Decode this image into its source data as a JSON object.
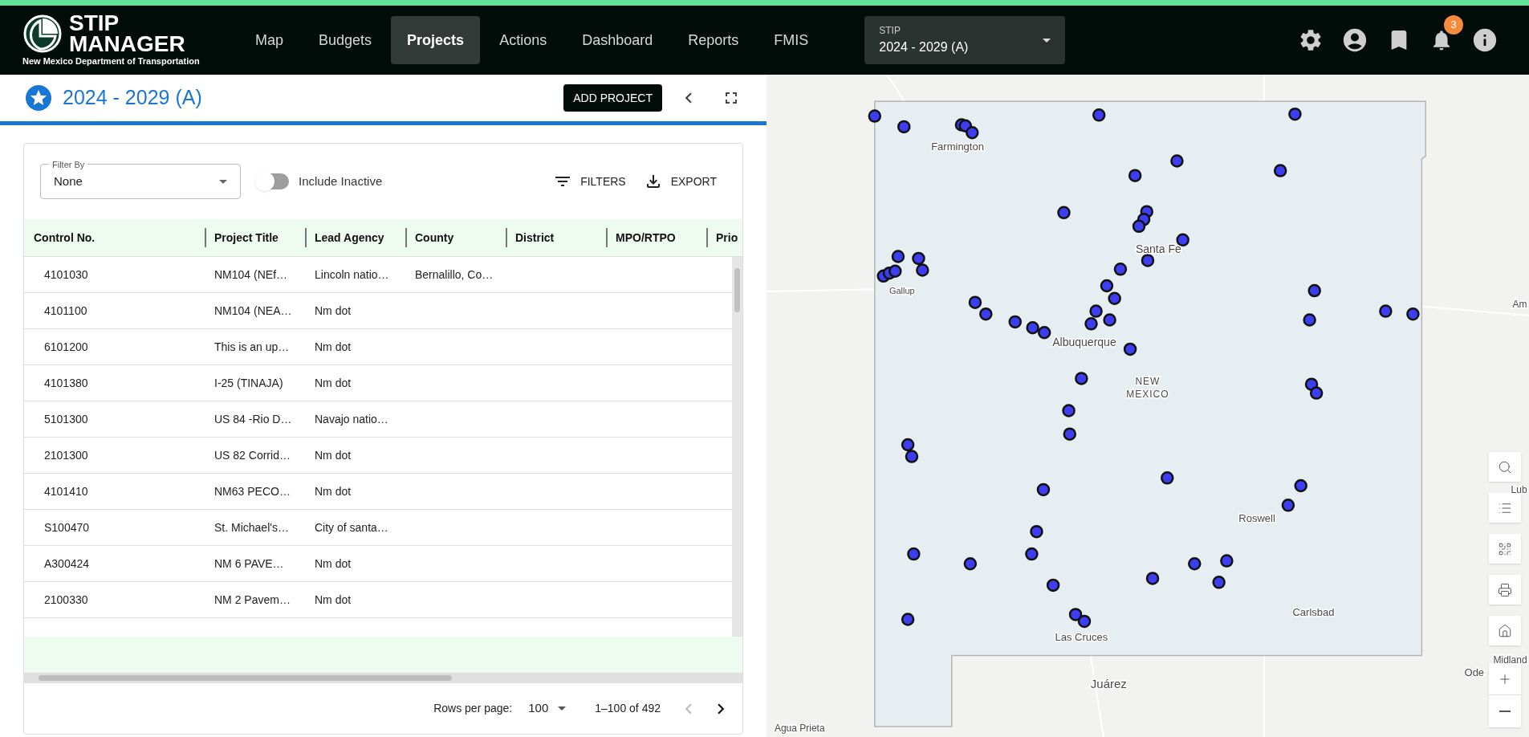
{
  "header": {
    "brand": {
      "title_line_1": "STIP",
      "title_line_2": "MANAGER",
      "subtitle": "New Mexico Department of Transportation"
    },
    "nav": [
      {
        "label": "Map",
        "selected": false
      },
      {
        "label": "Budgets",
        "selected": false
      },
      {
        "label": "Projects",
        "selected": true
      },
      {
        "label": "Actions",
        "selected": false
      },
      {
        "label": "Dashboard",
        "selected": false
      },
      {
        "label": "Reports",
        "selected": false
      },
      {
        "label": "FMIS",
        "selected": false
      }
    ],
    "stip_select": {
      "label": "STIP",
      "value": "2024 - 2029 (A)"
    },
    "notifications": {
      "badge": "3"
    }
  },
  "panel": {
    "title": "2024 - 2029 (A)",
    "add_button": "ADD PROJECT",
    "filter": {
      "label": "Filter By",
      "value": "None"
    },
    "include_inactive": {
      "label": "Include Inactive",
      "on": false
    },
    "filters_button": "FILTERS",
    "export_button": "EXPORT"
  },
  "table": {
    "columns": [
      "Control No.",
      "Project Title",
      "Lead Agency",
      "County",
      "District",
      "MPO/RTPO",
      "Prio"
    ],
    "rows": [
      {
        "control_no": "4101030",
        "project_title": "NM104 (NEf…",
        "lead_agency": "Lincoln natio…",
        "county": "Bernalillo, Co…"
      },
      {
        "control_no": "4101100",
        "project_title": "NM104 (NEA…",
        "lead_agency": "Nm dot"
      },
      {
        "control_no": "6101200",
        "project_title": "This is an up…",
        "lead_agency": "Nm dot"
      },
      {
        "control_no": "4101380",
        "project_title": "I-25 (TINAJA)",
        "lead_agency": "Nm dot"
      },
      {
        "control_no": "5101300",
        "project_title": "US 84 -Rio D…",
        "lead_agency": "Navajo natio…"
      },
      {
        "control_no": "2101300",
        "project_title": "US 82 Corrid…",
        "lead_agency": "Nm dot"
      },
      {
        "control_no": "4101410",
        "project_title": "NM63 PECO…",
        "lead_agency": "Nm dot"
      },
      {
        "control_no": "S100470",
        "project_title": "St. Michael's…",
        "lead_agency": "City of santa…"
      },
      {
        "control_no": "A300424",
        "project_title": "NM 6 PAVE…",
        "lead_agency": "Nm dot"
      },
      {
        "control_no": "2100330",
        "project_title": "NM 2 Pavem…",
        "lead_agency": "Nm dot"
      }
    ]
  },
  "pagination": {
    "rows_per_page_label": "Rows per page:",
    "rows_per_page": "100",
    "range": "1–100 of 492",
    "previous_disabled": true,
    "next_disabled": false
  },
  "map": {
    "labels": [
      "Farmington",
      "Gallup",
      "Santa Fe",
      "Albuquerque",
      "NEW",
      "MEXICO",
      "Roswell",
      "Carlsbad",
      "Las Cruces",
      "Juárez",
      "Agua Prieta",
      "Am",
      "Lub",
      "Midland",
      "Ode"
    ]
  }
}
